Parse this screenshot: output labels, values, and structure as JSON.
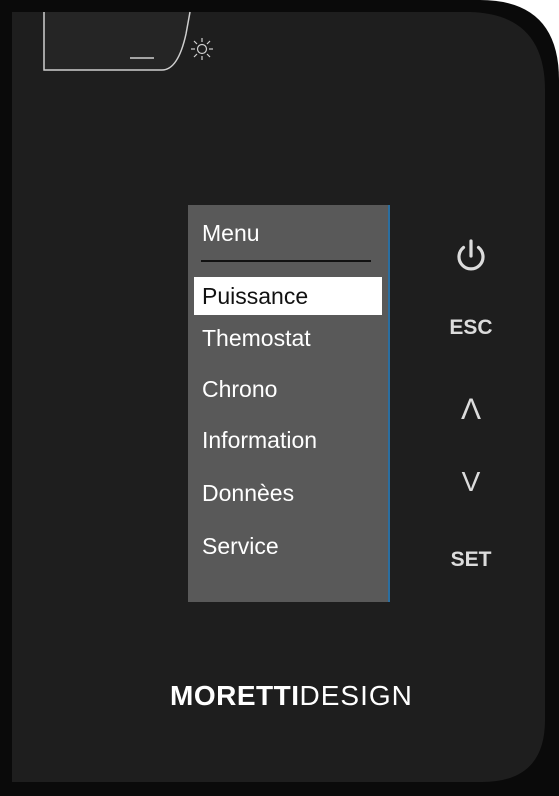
{
  "device": {
    "brand_strong": "MORETTI",
    "brand_light": "DESIGN"
  },
  "indicator": {
    "icon": "sun-icon"
  },
  "menu": {
    "title": "Menu",
    "items": [
      {
        "label": "Puissance",
        "selected": true
      },
      {
        "label": "Themostat",
        "selected": false
      },
      {
        "label": "Chrono",
        "selected": false
      },
      {
        "label": "Information",
        "selected": false
      },
      {
        "label": "Donnèes",
        "selected": false
      },
      {
        "label": "Service",
        "selected": false
      }
    ]
  },
  "buttons": {
    "power_icon": "power-icon",
    "esc_label": "ESC",
    "up_label": "Λ",
    "down_label": "V",
    "set_label": "SET"
  },
  "colors": {
    "body": "#1e1e1e",
    "frame": "#0a0a0a",
    "screen_bg": "#595959",
    "selected_bg": "#ffffff",
    "accent_edge": "#2a6ea0"
  }
}
